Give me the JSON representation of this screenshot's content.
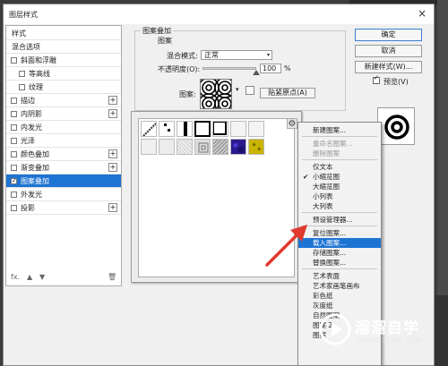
{
  "dialog": {
    "title": "图层样式",
    "close": "×"
  },
  "style_list": {
    "items": [
      {
        "label": "样式",
        "type": "header"
      },
      {
        "label": "混合选项",
        "type": "header"
      },
      {
        "label": "斜面和浮雕",
        "type": "item"
      },
      {
        "label": "等高线",
        "type": "sub"
      },
      {
        "label": "纹理",
        "type": "sub"
      },
      {
        "label": "描边",
        "type": "item",
        "plus": "+"
      },
      {
        "label": "内阴影",
        "type": "item",
        "plus": "+"
      },
      {
        "label": "内发光",
        "type": "item"
      },
      {
        "label": "光泽",
        "type": "item"
      },
      {
        "label": "颜色叠加",
        "type": "item",
        "plus": "+"
      },
      {
        "label": "渐变叠加",
        "type": "item",
        "plus": "+"
      },
      {
        "label": "图案叠加",
        "type": "item",
        "selected": true
      },
      {
        "label": "外发光",
        "type": "item"
      },
      {
        "label": "投影",
        "type": "item",
        "plus": "+"
      }
    ],
    "footer": {
      "fx": "fx.",
      "up": "▲",
      "down": "▼",
      "trash": "🗑"
    }
  },
  "pattern_overlay": {
    "group_title": "图案叠加",
    "sub_title": "图案",
    "blend_mode_label": "混合模式:",
    "blend_mode_value": "正常",
    "opacity_label": "不透明度(O):",
    "opacity_value": "100",
    "opacity_unit": "%",
    "pattern_label": "图案:",
    "snap_button": "贴紧原点(A)"
  },
  "buttons": {
    "ok": "确定",
    "cancel": "取消",
    "new_style": "新建样式(W)...",
    "preview": "预览(V)"
  },
  "menu": {
    "items": [
      {
        "label": "新建图案...",
        "state": "normal"
      },
      {
        "sep": true
      },
      {
        "label": "重命名图案...",
        "state": "disabled"
      },
      {
        "label": "删除图案",
        "state": "disabled"
      },
      {
        "sep": true
      },
      {
        "label": "仅文本",
        "state": "normal"
      },
      {
        "label": "小缩览图",
        "state": "checked",
        "check": "✔"
      },
      {
        "label": "大缩览图",
        "state": "normal"
      },
      {
        "label": "小列表",
        "state": "normal"
      },
      {
        "label": "大列表",
        "state": "normal"
      },
      {
        "sep": true
      },
      {
        "label": "预设管理器...",
        "state": "normal"
      },
      {
        "sep": true
      },
      {
        "label": "复位图案...",
        "state": "normal"
      },
      {
        "label": "载入图案...",
        "state": "highlighted"
      },
      {
        "label": "存储图案...",
        "state": "normal"
      },
      {
        "label": "替换图案...",
        "state": "normal"
      },
      {
        "sep": true
      },
      {
        "label": "艺术表面",
        "state": "normal"
      },
      {
        "label": "艺术家画笔画布",
        "state": "normal"
      },
      {
        "label": "彩色纸",
        "state": "normal"
      },
      {
        "label": "灰度纸",
        "state": "normal"
      },
      {
        "label": "自然图案",
        "state": "normal"
      },
      {
        "label": "图案 2",
        "state": "normal"
      },
      {
        "label": "图案",
        "state": "normal"
      }
    ]
  },
  "watermark": {
    "title": "溜溜自学",
    "subtitle": "ZIXUE.3D66.COM"
  },
  "colors": {
    "selection": "#1e74d3",
    "arrow": "#e03a2f",
    "dark_bg": "#3c3c3c"
  }
}
